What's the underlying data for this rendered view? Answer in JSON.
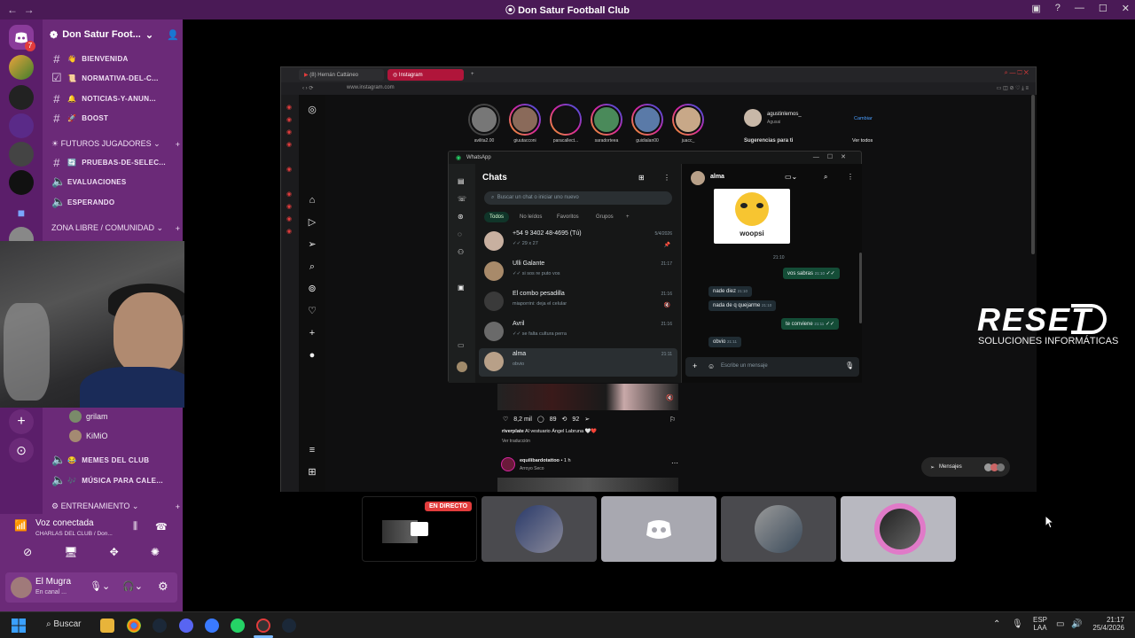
{
  "window": {
    "title": "Don Satur Football Club",
    "back": "←",
    "forward": "→"
  },
  "server": {
    "name": "Don Satur Foot...",
    "badge": "7",
    "channels": [
      {
        "icon": "👋",
        "label": "BIENVENIDA"
      },
      {
        "icon": "📜",
        "label": "NORMATIVA-DEL-C..."
      },
      {
        "icon": "🔔",
        "label": "NOTICIAS-Y-ANUN..."
      },
      {
        "icon": "🚀",
        "label": "BOOST"
      }
    ],
    "category_futuros": "FUTUROS JUGADORES",
    "channels_futuros": [
      {
        "icon": "🔄",
        "label": "PRUEBAS-DE-SELEC..."
      },
      {
        "icon": "",
        "label": "EVALUACIONES"
      },
      {
        "icon": "",
        "label": "ESPERANDO"
      }
    ],
    "category_zona": "ZONA LIBRE / COMUNIDAD",
    "voice_users": [
      "grilam",
      "KiMiO"
    ],
    "channels_after": [
      {
        "icon": "😂",
        "label": "MEMES DEL CLUB"
      },
      {
        "icon": "🎶",
        "label": "MÚSICA PARA CALE..."
      }
    ],
    "category_entrenamiento": "ENTRENAMIENTO"
  },
  "voice": {
    "status": "Voz conectada",
    "channel": "CHARLAS DEL CLUB / Don..."
  },
  "user": {
    "name": "El Mugra",
    "status": "En canal ..."
  },
  "browser": {
    "tab1": "(8) Hernán Cattáneo",
    "tab2": "Instagram",
    "url": "www.instagram.com",
    "profile_account": "agustinlemos_",
    "profile_sub": "Agusai",
    "switch_label": "Cambiar",
    "suggestions": "Sugerencias para ti",
    "see_all": "Ver todos",
    "stories": [
      "avilita2.00",
      "giuutacconi",
      "paracallect...",
      "saradorteea",
      "guidialan00",
      "juacc_"
    ],
    "post": {
      "likes": "8,2 mil",
      "comments": "89",
      "shares": "92",
      "caption_user": "riverplate",
      "caption_text": "Al vestuario Ángel Labruna 🤍❤️",
      "see_translation": "Ver traducción",
      "next_user": "equilibardotattoo",
      "next_time": "1 h",
      "next_location": "Arroyo Seco"
    },
    "messages_label": "Mensajes"
  },
  "whatsapp": {
    "app_title": "WhatsApp",
    "list_title": "Chats",
    "search_placeholder": "Buscar un chat o iniciar uno nuevo",
    "filters": [
      "Todos",
      "No leídos",
      "Favoritos",
      "Grupos"
    ],
    "chats": [
      {
        "name": "+54 9 3402 48-4695 (Tú)",
        "preview": "29 x 27",
        "time": "5/4/2026"
      },
      {
        "name": "Ulli Galante",
        "preview": "si sos re puto vos",
        "time": "21:17"
      },
      {
        "name": "El combo pesadilla",
        "preview": "miaporrini: deja el celular",
        "time": "21:16"
      },
      {
        "name": "Avril",
        "preview": "se falta cultura perra",
        "time": "21:16"
      },
      {
        "name": "alma",
        "preview": "obvio",
        "time": "21:11"
      }
    ],
    "active_contact": "alma",
    "sticker_text": "woopsi",
    "messages": [
      {
        "text": "21:10",
        "dir": "sys"
      },
      {
        "text": "vos sabras",
        "dir": "out",
        "time": "21:10"
      },
      {
        "text": "nade diez",
        "dir": "in",
        "time": "21:10"
      },
      {
        "text": "nada de q quejarme",
        "dir": "in",
        "time": "21:10"
      },
      {
        "text": "te conviene",
        "dir": "out",
        "time": "21:11"
      },
      {
        "text": "obvio",
        "dir": "in",
        "time": "21:11"
      }
    ],
    "compose_placeholder": "Escribe un mensaje"
  },
  "watermark": {
    "brand": "RESET",
    "tagline": "SOLUCIONES INFORMÁTICAS"
  },
  "call": {
    "live_label": "EN DIRECTO"
  },
  "taskbar": {
    "search": "Buscar",
    "lang": "ESP",
    "lang2": "LAA",
    "time": "21:17",
    "date": "25/4/2026"
  },
  "colors": {
    "discord_purple": "#6b2a78",
    "discord_dark": "#5b1e6a",
    "live_red": "#e23c3c",
    "wa_green": "#144d37"
  }
}
